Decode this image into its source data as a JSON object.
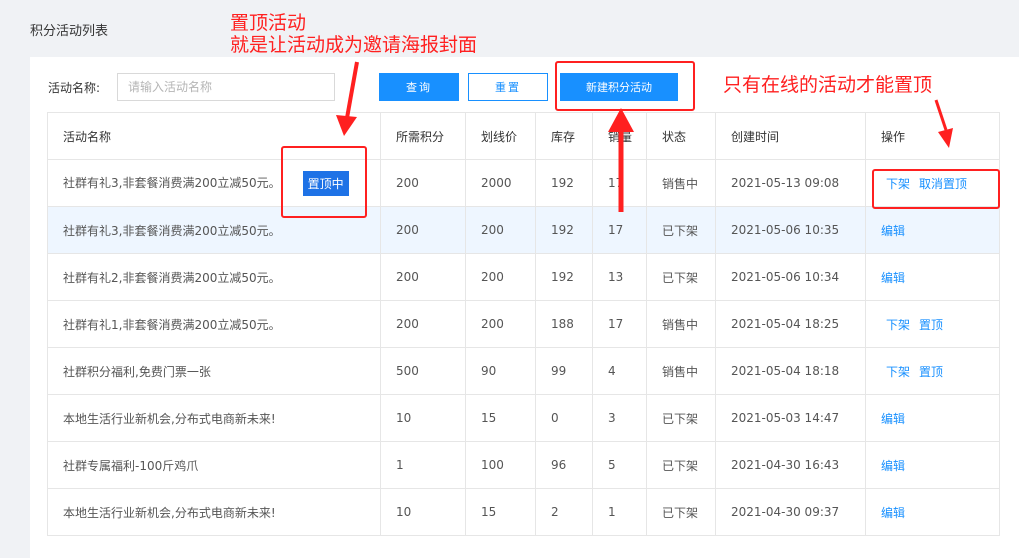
{
  "page": {
    "title": "积分活动列表"
  },
  "filter": {
    "label": "活动名称:",
    "placeholder": "请输入活动名称",
    "query_label": "查询",
    "reset_label": "重置",
    "new_label": "新建积分活动"
  },
  "table": {
    "headers": [
      "活动名称",
      "所需积分",
      "划线价",
      "库存",
      "销量",
      "状态",
      "创建时间",
      "操作"
    ],
    "rows": [
      {
        "name": "社群有礼3,非套餐消费满200立减50元。",
        "badge": "置顶中",
        "points": "200",
        "price": "2000",
        "stock": "192",
        "sales": "17",
        "status": "销售中",
        "created": "2021-05-13 09:08",
        "actions": [
          "下架",
          "取消置顶"
        ]
      },
      {
        "name": "社群有礼3,非套餐消费满200立减50元。",
        "points": "200",
        "price": "200",
        "stock": "192",
        "sales": "17",
        "status": "已下架",
        "created": "2021-05-06 10:35",
        "actions": [
          "编辑"
        ]
      },
      {
        "name": "社群有礼2,非套餐消费满200立减50元。",
        "points": "200",
        "price": "200",
        "stock": "192",
        "sales": "13",
        "status": "已下架",
        "created": "2021-05-06 10:34",
        "actions": [
          "编辑"
        ]
      },
      {
        "name": "社群有礼1,非套餐消费满200立减50元。",
        "points": "200",
        "price": "200",
        "stock": "188",
        "sales": "17",
        "status": "销售中",
        "created": "2021-05-04 18:25",
        "actions": [
          "下架",
          "置顶"
        ]
      },
      {
        "name": "社群积分福利,免费门票一张",
        "points": "500",
        "price": "90",
        "stock": "99",
        "sales": "4",
        "status": "销售中",
        "created": "2021-05-04 18:18",
        "actions": [
          "下架",
          "置顶"
        ]
      },
      {
        "name": "本地生活行业新机会,分布式电商新未来!",
        "points": "10",
        "price": "15",
        "stock": "0",
        "sales": "3",
        "status": "已下架",
        "created": "2021-05-03 14:47",
        "actions": [
          "编辑"
        ]
      },
      {
        "name": "社群专属福利-100斤鸡爪",
        "points": "1",
        "price": "100",
        "stock": "96",
        "sales": "5",
        "status": "已下架",
        "created": "2021-04-30 16:43",
        "actions": [
          "编辑"
        ]
      },
      {
        "name": "本地生活行业新机会,分布式电商新未来!",
        "points": "10",
        "price": "15",
        "stock": "2",
        "sales": "1",
        "status": "已下架",
        "created": "2021-04-30 09:37",
        "actions": [
          "编辑"
        ]
      }
    ]
  },
  "annotations": {
    "pin_line1": "置顶活动",
    "pin_line2": "就是让活动成为邀请海报封面",
    "online_only": "只有在线的活动才能置顶",
    "color": "#ff2020"
  },
  "colors": {
    "primary": "#1890ff",
    "badge": "#1e72e6",
    "highlight_row": "#eef6ff"
  }
}
